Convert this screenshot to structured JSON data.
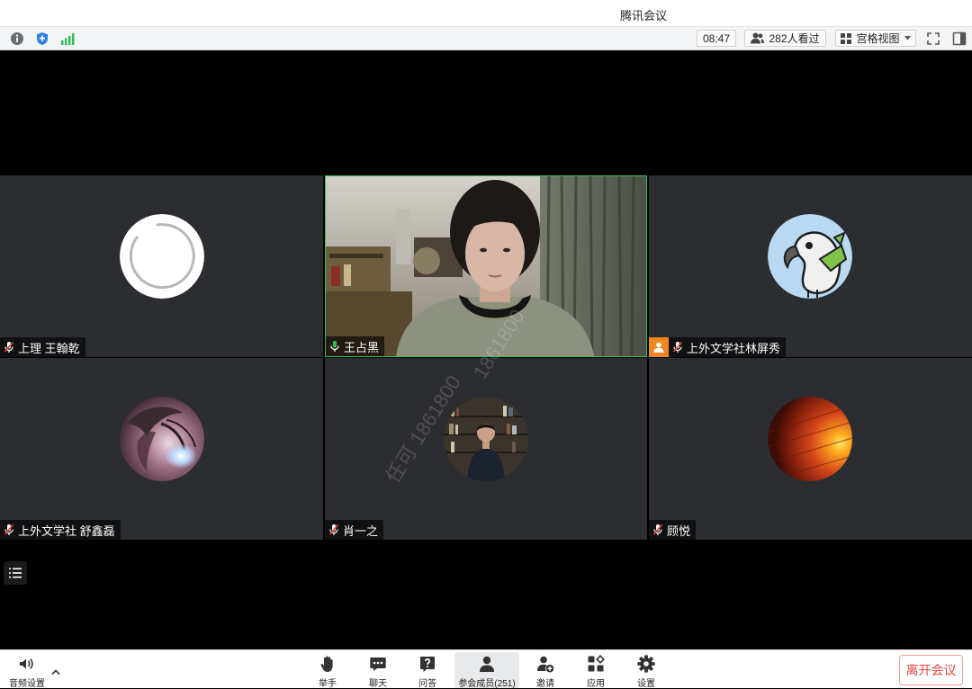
{
  "app": {
    "title": "腾讯会议"
  },
  "status_bar": {
    "info_icon": "info-icon",
    "security_icon": "shield-icon",
    "network_icon": "signal-bars-icon",
    "time": "08:47",
    "viewers": "282人看过",
    "viewers_icon": "people-icon",
    "view_mode": "宫格视图",
    "view_mode_icon": "grid-view-icon",
    "fullscreen_icon": "fullscreen-icon",
    "sidebar_icon": "sidebar-toggle-icon"
  },
  "participants": [
    {
      "name": "上理 王翰乾",
      "mic": "muted",
      "avatar": "loading-ring-avatar"
    },
    {
      "name": "王占黑",
      "mic": "on",
      "video": "on",
      "active_speaker": true
    },
    {
      "name": "上外文学社林屏秀",
      "mic": "muted",
      "avatar": "parrot-avatar",
      "badge": "host-icon"
    },
    {
      "name": "上外文学社 舒鑫磊",
      "mic": "muted",
      "avatar": "anime-portrait-avatar"
    },
    {
      "name": "肖一之",
      "mic": "muted",
      "avatar": "bookshelf-photo-avatar"
    },
    {
      "name": "顾悦",
      "mic": "muted",
      "avatar": "orange-wood-avatar"
    }
  ],
  "watermark": {
    "name": "任可",
    "number": "1861800"
  },
  "toolbar": {
    "audio_settings": "音频设置",
    "raise_hand": "举手",
    "chat": "聊天",
    "qa": "问答",
    "participants": "参会成员(251)",
    "invite": "邀请",
    "apps": "应用",
    "settings": "设置",
    "leave": "离开会议"
  },
  "colors": {
    "accent_green": "#2fbf58",
    "leave_red": "#e5483f",
    "host_badge": "#f0861f",
    "tile_bg": "#2c2d30",
    "shield_blue": "#2f7fe9"
  }
}
